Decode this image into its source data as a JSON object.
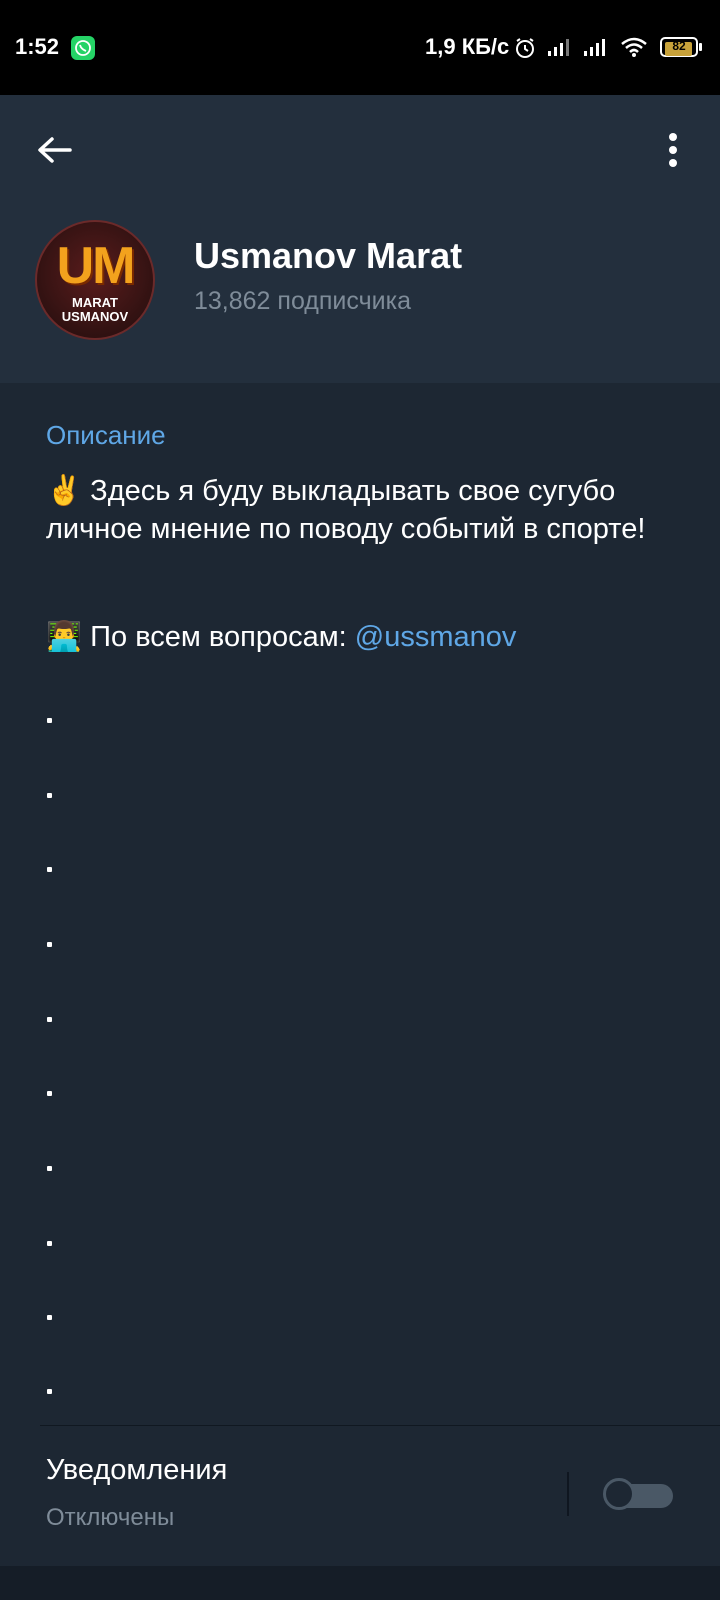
{
  "status_bar": {
    "time": "1:52",
    "net_speed": "1,9 КБ/с",
    "battery": "82",
    "icons": [
      "whatsapp-icon",
      "alarm-icon",
      "signal-icon",
      "signal-icon",
      "wifi-icon",
      "battery-icon"
    ]
  },
  "header": {
    "back_icon": "arrow-left-icon",
    "menu_icon": "more-vertical-icon",
    "avatar": {
      "logo_letters": "UM",
      "logo_line1": "MARAT",
      "logo_line2": "USMANOV"
    },
    "channel_name": "Usmanov Marat",
    "subscribers": "13,862 подписчика"
  },
  "description": {
    "title": "Описание",
    "emoji1": "✌️",
    "text": "Здесь я буду выкладывать свое сугубо личное мнение по поводу событий в спорте!",
    "emoji2": "👨‍💻",
    "contact_prefix": "По всем вопросам: ",
    "contact_mention": "@ussmanov",
    "dots": [
      ".",
      ".",
      ".",
      ".",
      ".",
      ".",
      ".",
      ".",
      ".",
      "."
    ]
  },
  "notifications": {
    "label": "Уведомления",
    "state": "Отключены",
    "toggle_on": false
  },
  "colors": {
    "background": "#1d2733",
    "header": "#232f3d",
    "accent": "#5fa7e6",
    "secondary_text": "#7f8c99"
  }
}
